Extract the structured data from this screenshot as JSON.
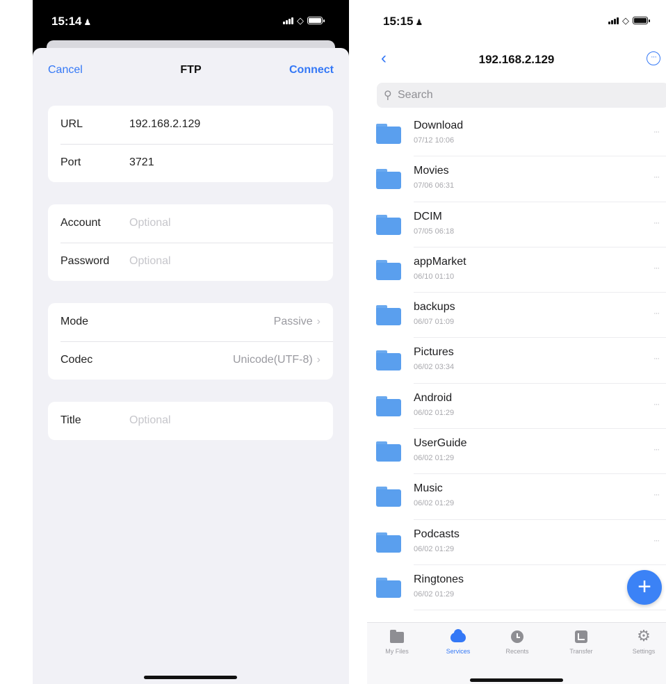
{
  "left": {
    "status": {
      "time": "15:14"
    },
    "nav": {
      "cancel": "Cancel",
      "title": "FTP",
      "connect": "Connect"
    },
    "server": {
      "url_label": "URL",
      "url_value": "192.168.2.129",
      "port_label": "Port",
      "port_value": "3721"
    },
    "auth": {
      "account_label": "Account",
      "account_placeholder": "Optional",
      "password_label": "Password",
      "password_placeholder": "Optional"
    },
    "settings": {
      "mode_label": "Mode",
      "mode_value": "Passive",
      "codec_label": "Codec",
      "codec_value": "Unicode(UTF-8)"
    },
    "title_group": {
      "title_label": "Title",
      "title_placeholder": "Optional"
    }
  },
  "right": {
    "status": {
      "time": "15:15"
    },
    "nav": {
      "title": "192.168.2.129"
    },
    "search": {
      "placeholder": "Search"
    },
    "files": [
      {
        "name": "Download",
        "date": "07/12 10:06"
      },
      {
        "name": "Movies",
        "date": "07/06 06:31"
      },
      {
        "name": "DCIM",
        "date": "07/05 06:18"
      },
      {
        "name": "appMarket",
        "date": "06/10 01:10"
      },
      {
        "name": "backups",
        "date": "06/07 01:09"
      },
      {
        "name": "Pictures",
        "date": "06/02 03:34"
      },
      {
        "name": "Android",
        "date": "06/02 01:29"
      },
      {
        "name": "UserGuide",
        "date": "06/02 01:29"
      },
      {
        "name": "Music",
        "date": "06/02 01:29"
      },
      {
        "name": "Podcasts",
        "date": "06/02 01:29"
      },
      {
        "name": "Ringtones",
        "date": "06/02 01:29"
      }
    ],
    "tabs": [
      {
        "label": "My Files",
        "icon": "folder-icon"
      },
      {
        "label": "Services",
        "icon": "cloud-icon"
      },
      {
        "label": "Recents",
        "icon": "clock-icon"
      },
      {
        "label": "Transfer",
        "icon": "transfer-icon"
      },
      {
        "label": "Settings",
        "icon": "gear-icon"
      }
    ],
    "active_tab": "Services"
  },
  "colors": {
    "accent": "#3478f6",
    "folder": "#5a9fee",
    "grouped_bg": "#f1f1f6"
  }
}
